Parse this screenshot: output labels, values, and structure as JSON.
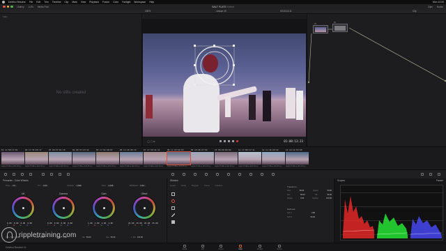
{
  "menubar": {
    "app": "DaVinci Resolve",
    "items": [
      "File",
      "Edit",
      "Trim",
      "Timeline",
      "Clip",
      "Mark",
      "View",
      "Playback",
      "Fusion",
      "Color",
      "Fairlight",
      "Workspace",
      "Help"
    ],
    "clock": "Mon 12:00"
  },
  "toolbar": {
    "project": "SALT FLATS",
    "project_state": "Edited",
    "gallery": "Gallery",
    "luts": "LUTs",
    "media_pool": "Media Pool",
    "clips": "Clips",
    "nodes": "Nodes"
  },
  "viewer": {
    "zoom": "100%",
    "clip_name": "Lesson 19",
    "timecode_top": "00:20:14:11",
    "timecode": "01:00:13:23",
    "clip_label": "Clip"
  },
  "gallery": {
    "tab": "Stills",
    "empty_text": "No stills created"
  },
  "nodes": {
    "node1": "01",
    "node2": "02"
  },
  "clips": [
    {
      "num": "01",
      "tc": "11:58:17:01",
      "codec": "Apple ProRes 422 Proxy"
    },
    {
      "num": "02",
      "tc": "17:34:26:17",
      "codec": "Apple ProRes 422 Proxy"
    },
    {
      "num": "03",
      "tc": "06:57:01:15",
      "codec": "Apple ProRes 422 Proxy"
    },
    {
      "num": "04",
      "tc": "09:37:23:12",
      "codec": "Apple ProRes 422 Proxy"
    },
    {
      "num": "05",
      "tc": "17:52:48:07",
      "codec": "Apple ProRes 422 Proxy"
    },
    {
      "num": "06",
      "tc": "11:16:46:13",
      "codec": "Apple ProRes 422 Proxy"
    },
    {
      "num": "07",
      "tc": "17:39:41:11",
      "codec": "Apple ProRes 422 Proxy"
    },
    {
      "num": "08",
      "tc": "11:20:02:03",
      "codec": "Apple ProRes 422 Proxy"
    },
    {
      "num": "09",
      "tc": "10:26:27:04",
      "codec": "Apple ProRes 422 Proxy"
    },
    {
      "num": "10",
      "tc": "08:20:06:04",
      "codec": "Apple ProRes 422 Proxy"
    },
    {
      "num": "11",
      "tc": "17:08:17:11",
      "codec": "Apple ProRes 422 Proxy"
    },
    {
      "num": "12",
      "tc": "11:16:29:22",
      "codec": "Apple ProRes 422 Proxy"
    },
    {
      "num": "13",
      "tc": "10:14:55:06",
      "codec": "Apple ProRes 422 Proxy"
    }
  ],
  "color_wheels": {
    "title": "Primaries - Color Wheels",
    "params_top": [
      {
        "label": "Temp",
        "value": "0.0"
      },
      {
        "label": "Tint",
        "value": "0.00"
      },
      {
        "label": "Contrast",
        "value": "1.000"
      },
      {
        "label": "Pivot",
        "value": "0.435"
      },
      {
        "label": "Mid/Detail",
        "value": "0.00"
      }
    ],
    "wheels": [
      {
        "label": "Lift",
        "y": "0.00",
        "r": "0.00",
        "g": "0.00",
        "b": "0.00"
      },
      {
        "label": "Gamma",
        "y": "0.00",
        "r": "0.00",
        "g": "0.00",
        "b": "0.00"
      },
      {
        "label": "Gain",
        "y": "1.00",
        "r": "1.00",
        "g": "1.00",
        "b": "1.00"
      },
      {
        "label": "Offset",
        "y": "25.00",
        "r": "25.00",
        "g": "25.00",
        "b": "25.00"
      }
    ],
    "channel_labels": [
      "Y",
      "R",
      "G",
      "B"
    ],
    "params_bottom": [
      {
        "label": "Color Boost",
        "value": "0.00"
      },
      {
        "label": "Shad",
        "value": "0.00"
      },
      {
        "label": "Hi/Light",
        "value": "0.00"
      },
      {
        "label": "Sat",
        "value": "50.00"
      },
      {
        "label": "Hue",
        "value": "50.00"
      },
      {
        "label": "L. Mix",
        "value": "100.00"
      }
    ]
  },
  "window_panel": {
    "title": "Window",
    "tabs": [
      "Linear",
      "Circle",
      "Polygon",
      "Curve",
      "Gradient"
    ],
    "transform_title": "Transform",
    "transform": [
      {
        "label": "Size",
        "value": "50.00",
        "label2": "Aspect",
        "value2": "50.00"
      },
      {
        "label": "Pan",
        "value": "50.00",
        "label2": "Tilt",
        "value2": "50.00"
      },
      {
        "label": "Rotate",
        "value": "0.00",
        "label2": "Opacity",
        "value2": "100.00"
      }
    ],
    "softness_title": "Softness",
    "softness": [
      {
        "label": "Soft 1",
        "value": "2.80"
      },
      {
        "label": "Soft 2",
        "value": "50.00"
      }
    ]
  },
  "scope": {
    "title": "Scopes",
    "mode": "Parade"
  },
  "pages": {
    "brand": "DaVinci Resolve 14",
    "items": [
      "Media",
      "Edit",
      "Fusion",
      "Color",
      "Fairlight",
      "Deliver"
    ],
    "active": "Color"
  },
  "watermark": "rippletraining.com"
}
